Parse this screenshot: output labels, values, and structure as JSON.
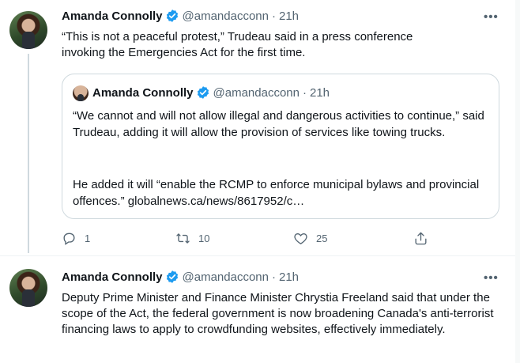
{
  "tweet1": {
    "name": "Amanda Connolly",
    "handle": "@amandacconn",
    "separator": "·",
    "time": "21h",
    "text": "“This is not a peaceful protest,” Trudeau said in a press conference invoking the Emergencies Act for the first time.",
    "more": "•••"
  },
  "quote": {
    "name": "Amanda Connolly",
    "handle": "@amandacconn",
    "separator": "·",
    "time": "21h",
    "para1": "“We cannot and will not allow illegal and dangerous activities to continue,” said Trudeau, adding it will allow the provision of services like towing trucks.",
    "para2": "He added it will “enable the RCMP to enforce municipal bylaws and provincial offences.” globalnews.ca/news/8617952/c…"
  },
  "actions": {
    "reply_count": "1",
    "retweet_count": "10",
    "like_count": "25"
  },
  "tweet2": {
    "name": "Amanda Connolly",
    "handle": "@amandacconn",
    "separator": "·",
    "time": "21h",
    "text": "Deputy Prime Minister and Finance Minister Chrystia Freeland said that under the scope of the Act, the federal government is now broadening Canada's anti-terrorist financing laws to apply to crowdfunding websites, effectively immediately.",
    "more": "•••"
  },
  "colors": {
    "verified": "#1d9bf0",
    "secondary_text": "#536471",
    "border": "#cfd9de"
  }
}
